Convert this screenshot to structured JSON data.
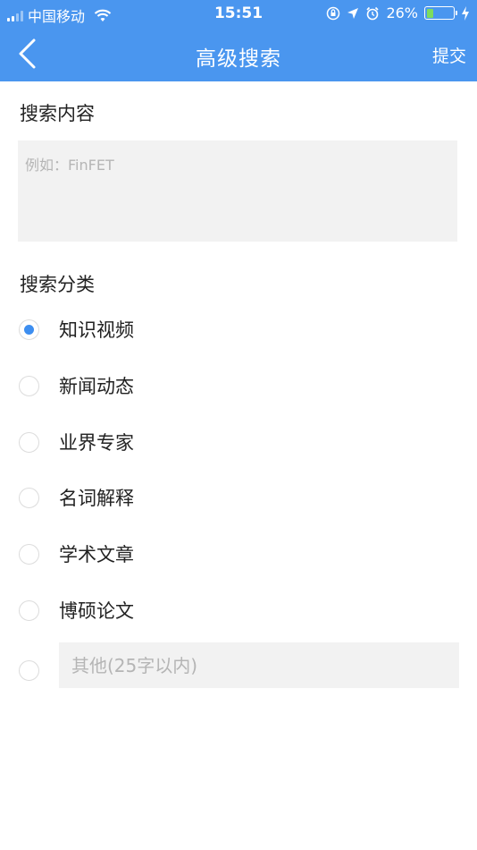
{
  "status_bar": {
    "carrier": "中国移动",
    "time": "15:51",
    "battery": "26%",
    "battery_level": 0.26
  },
  "nav": {
    "title": "高级搜索",
    "submit": "提交"
  },
  "search_content": {
    "label": "搜索内容",
    "placeholder": "例如：FinFET"
  },
  "category": {
    "label": "搜索分类",
    "options": [
      {
        "label": "知识视频",
        "checked": true
      },
      {
        "label": "新闻动态",
        "checked": false
      },
      {
        "label": "业界专家",
        "checked": false
      },
      {
        "label": "名词解释",
        "checked": false
      },
      {
        "label": "学术文章",
        "checked": false
      },
      {
        "label": "博硕论文",
        "checked": false
      }
    ],
    "other_placeholder": "其他(25字以内)"
  },
  "colors": {
    "header": "#4a96ef",
    "radio_selected": "#3d8ef0",
    "input_bg": "#f2f2f2"
  }
}
